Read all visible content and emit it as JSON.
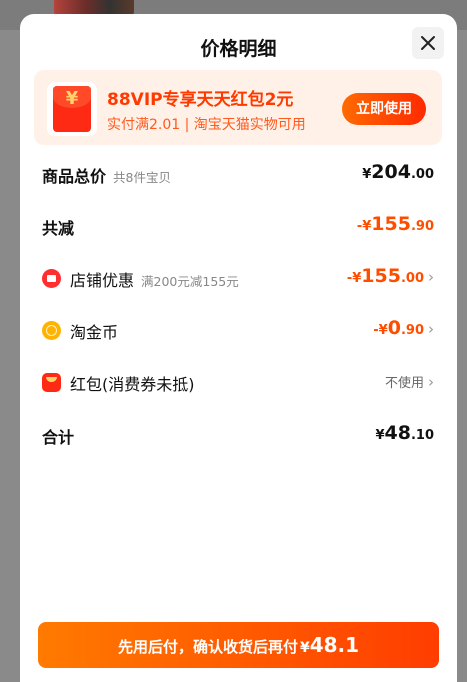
{
  "title": "价格明细",
  "coupon": {
    "icon_glyph": "¥",
    "title": "88VIP专享天天红包2元",
    "subtitle": "实付满2.01 | 淘宝天猫实物可用",
    "button": "立即使用"
  },
  "rows": {
    "total": {
      "label": "商品总价",
      "note": "共8件宝贝",
      "currency": "¥",
      "int": "204",
      "dec": ".00"
    },
    "reduce": {
      "label": "共减",
      "currency": "-¥",
      "int": "155",
      "dec": ".90"
    },
    "shop": {
      "label": "店铺优惠",
      "note": "满200元减155元",
      "currency": "-¥",
      "int": "155",
      "dec": ".00"
    },
    "coin": {
      "label": "淘金币",
      "currency": "-¥",
      "int": "0",
      "dec": ".90"
    },
    "hongbao": {
      "label": "红包(消费券未抵)",
      "value": "不使用"
    },
    "sum": {
      "label": "合计",
      "currency": "¥",
      "int": "48",
      "dec": ".10"
    }
  },
  "pay": {
    "text": "先用后付，确认收货后再付",
    "currency": "¥",
    "amount": "48.1"
  },
  "colors": {
    "accent": "#ff4d00",
    "coupon_bg": "#fff1e8"
  },
  "icons": {
    "close": "close-icon",
    "chevron": "chevron-right-icon"
  }
}
